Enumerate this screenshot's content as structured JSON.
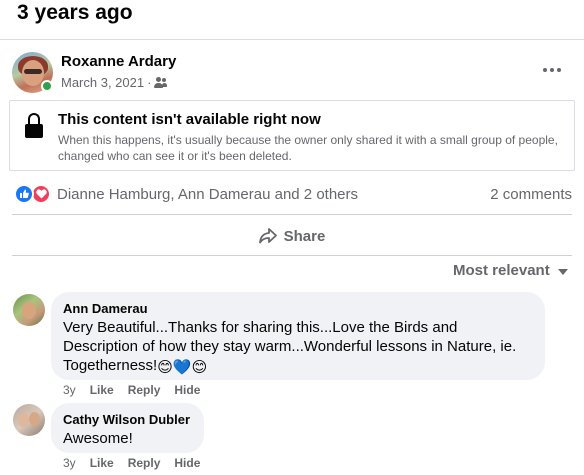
{
  "memory": {
    "title": "3 years ago"
  },
  "post": {
    "author": "Roxanne Ardary",
    "date": "March 3, 2021",
    "separator": "·",
    "audience_icon": "friends-icon",
    "more_icon": "more-horizontal-icon"
  },
  "unavailable": {
    "icon": "lock-icon",
    "title": "This content isn't available right now",
    "message": "When this happens, it's usually because the owner only shared it with a small group of people, changed who can see it or it's been deleted."
  },
  "reactions": {
    "icons": [
      "like-icon",
      "love-icon"
    ],
    "names": "Dianne Hamburg, Ann Damerau and 2 others",
    "comments_count": "2 comments"
  },
  "actions": {
    "share_label": "Share"
  },
  "sort": {
    "label": "Most relevant"
  },
  "comments": [
    {
      "author": "Ann Damerau",
      "text": "Very Beautiful...Thanks for sharing this...Love the Birds and Description of how they stay warm...Wonderful lessons in Nature, ie. Togetherness!",
      "emojis": [
        "😊",
        "💙",
        "😊"
      ],
      "age": "3y",
      "like": "Like",
      "reply": "Reply",
      "hide": "Hide"
    },
    {
      "author": "Cathy Wilson Dubler",
      "text": "Awesome!",
      "age": "3y",
      "like": "Like",
      "reply": "Reply",
      "hide": "Hide"
    }
  ],
  "colors": {
    "text_primary": "#050505",
    "text_secondary": "#65676b",
    "bubble_bg": "#f0f2f5",
    "online": "#31a24c",
    "like_blue": "#1877f2",
    "love_red": "#f33e58",
    "divider": "#ced0d4"
  }
}
